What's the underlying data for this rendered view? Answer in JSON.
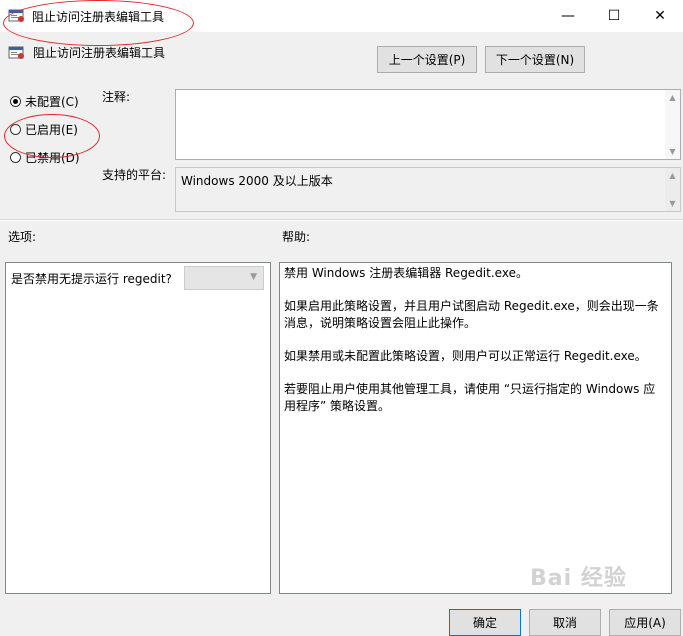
{
  "window": {
    "title": "阻止访问注册表编辑工具",
    "minimize_glyph": "—",
    "maximize_glyph": "☐",
    "close_glyph": "✕"
  },
  "header": {
    "policy_name": "阻止访问注册表编辑工具",
    "prev_button": "上一个设置(P)",
    "next_button": "下一个设置(N)"
  },
  "state": {
    "options": [
      {
        "label": "未配置(C)",
        "checked": true
      },
      {
        "label": "已启用(E)",
        "checked": false
      },
      {
        "label": "已禁用(D)",
        "checked": false
      }
    ]
  },
  "comment": {
    "label": "注释:",
    "value": ""
  },
  "platform": {
    "label": "支持的平台:",
    "value": "Windows 2000 及以上版本"
  },
  "options_section": {
    "label": "选项:",
    "prompt": "是否禁用无提示运行 regedit?",
    "dropdown_value": ""
  },
  "help_section": {
    "label": "帮助:",
    "paragraphs": [
      "禁用 Windows 注册表编辑器 Regedit.exe。",
      "如果启用此策略设置，并且用户试图启动 Regedit.exe，则会出现一条消息，说明策略设置会阻止此操作。",
      "如果禁用或未配置此策略设置，则用户可以正常运行 Regedit.exe。",
      "若要阻止用户使用其他管理工具，请使用 “只运行指定的 Windows 应用程序” 策略设置。"
    ]
  },
  "footer": {
    "ok": "确定",
    "cancel": "取消",
    "apply": "应用(A)"
  },
  "watermark": "Bai 经验",
  "colors": {
    "annotation": "#e0262b",
    "accent": "#0078d7"
  }
}
